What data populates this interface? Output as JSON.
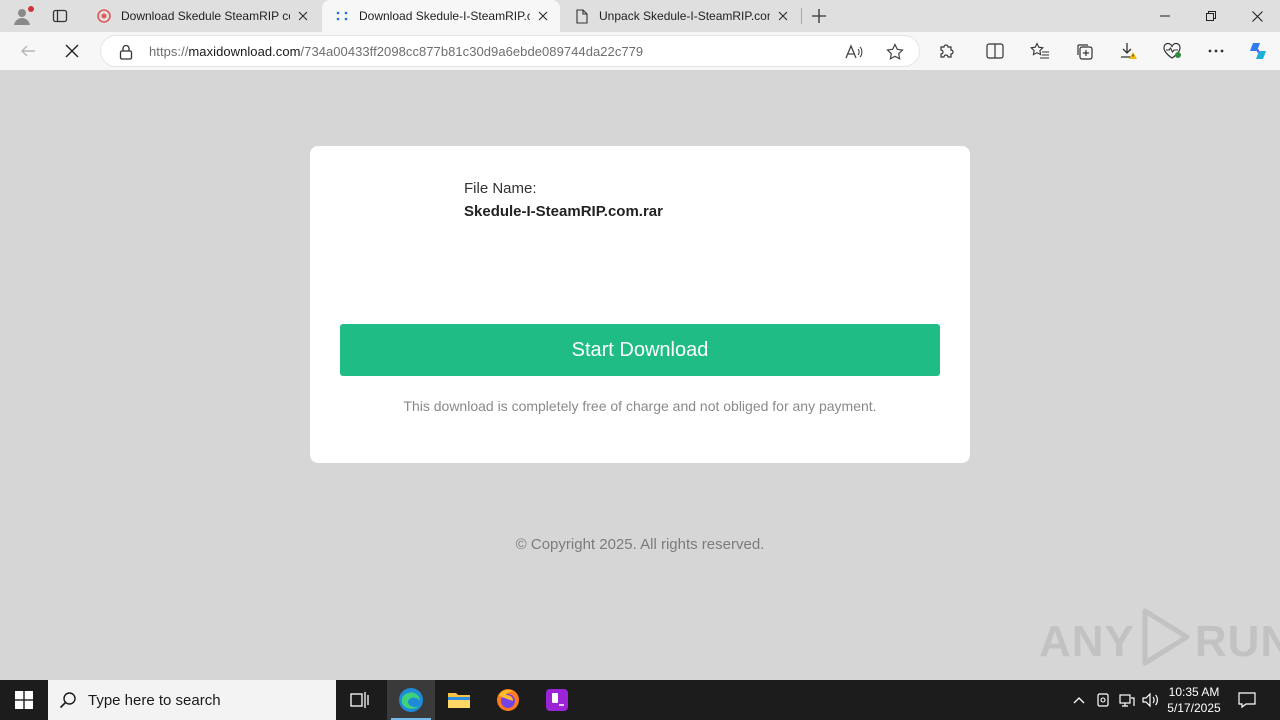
{
  "browser": {
    "tabs": [
      {
        "title": "Download Skedule SteamRIP com",
        "favicon": "steamrip-favicon",
        "active": false
      },
      {
        "title": "Download Skedule-I-SteamRIP.co",
        "favicon": "loading-spinner-icon",
        "active": true
      },
      {
        "title": "Unpack Skedule-I-SteamRIP.com",
        "favicon": "page-icon",
        "active": false
      }
    ],
    "address": {
      "scheme": "https://",
      "host": "maxidownload.com",
      "path": "/734a00433ff2098cc877b81c30d9a6ebde089744da22c779"
    }
  },
  "page": {
    "file_name_label": "File Name:",
    "file_name": "Skedule-I-SteamRIP.com.rar",
    "download_button": "Start Download",
    "free_note": "This download is completely free of charge and not obliged for any payment.",
    "copyright": "© Copyright 2025. All rights reserved.",
    "watermark_left": "ANY",
    "watermark_right": "RUN"
  },
  "taskbar": {
    "search_placeholder": "Type here to search",
    "time": "10:35 AM",
    "date": "5/17/2025"
  },
  "colors": {
    "accent_button": "#1fbd85",
    "page_background": "#d6d6d6",
    "active_app_underline": "#76b9ed"
  }
}
